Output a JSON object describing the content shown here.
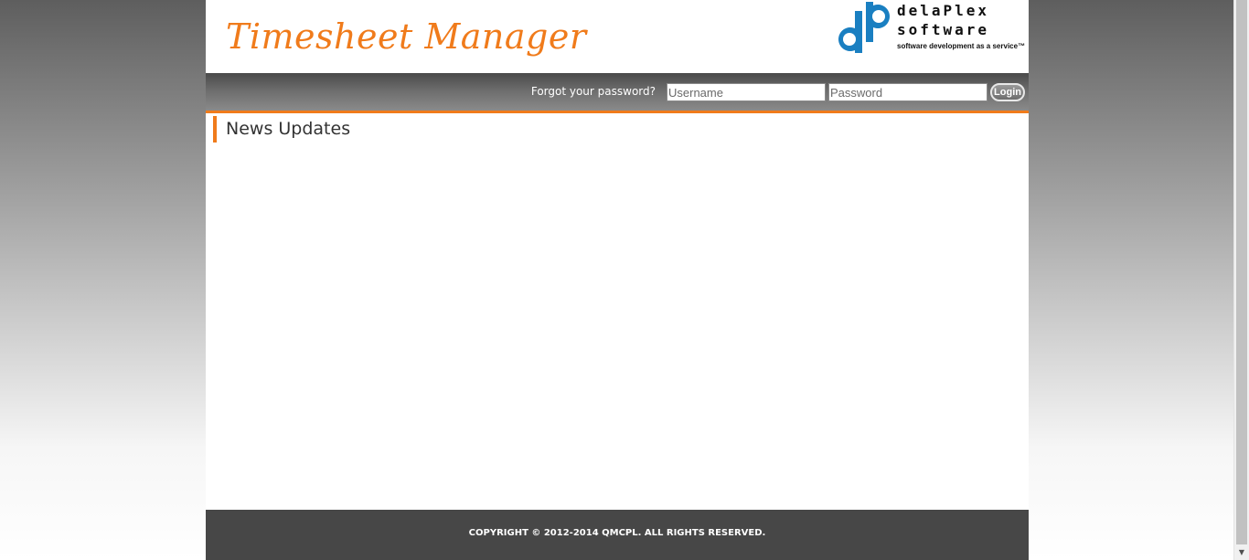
{
  "header": {
    "title": "Timesheet Manager",
    "logo": {
      "brand_line1": "delaPlex",
      "brand_line2": "software",
      "tagline": "software development as a service™",
      "icon": "dp-logo-icon",
      "color": "#1a7fc1"
    }
  },
  "login": {
    "forgot_password": "Forgot your password?",
    "username_placeholder": "Username",
    "password_placeholder": "Password",
    "login_label": "Login"
  },
  "main": {
    "heading": "News Updates"
  },
  "footer": {
    "copyright": "COPYRIGHT © 2012-2014 QMCPL. ALL RIGHTS RESERVED."
  },
  "colors": {
    "accent": "#f07b1b",
    "footer_bg": "#474747",
    "logo_blue": "#1a7fc1"
  }
}
